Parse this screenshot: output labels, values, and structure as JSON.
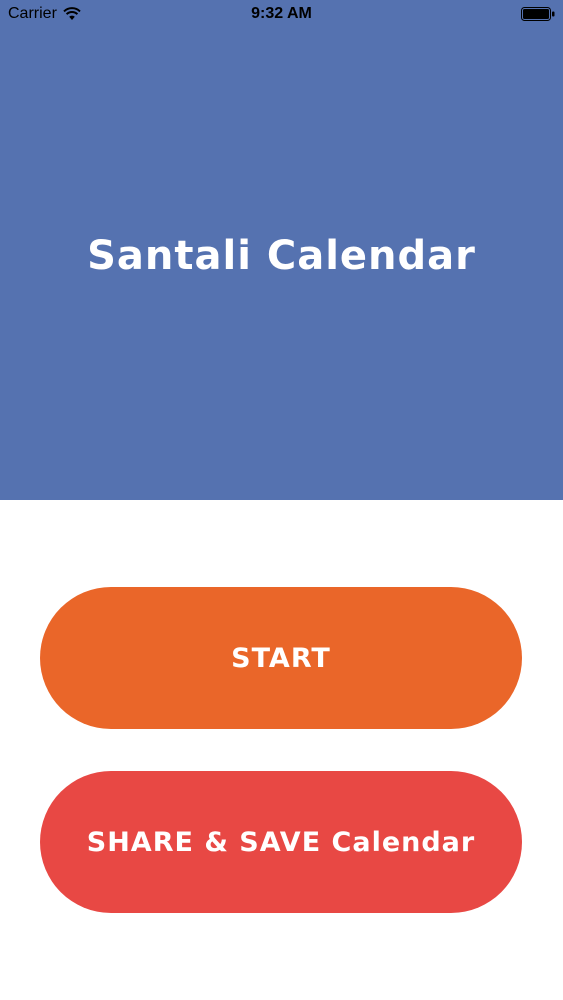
{
  "status_bar": {
    "carrier": "Carrier",
    "time": "9:32 AM"
  },
  "header": {
    "title": "Santali Calendar",
    "background_color": "#5572b0"
  },
  "buttons": {
    "start_label": "START",
    "start_color": "#ea6629",
    "share_label": "SHARE & SAVE Calendar",
    "share_color": "#e84844"
  },
  "icons": {
    "wifi": "wifi-icon",
    "battery": "battery-icon"
  }
}
